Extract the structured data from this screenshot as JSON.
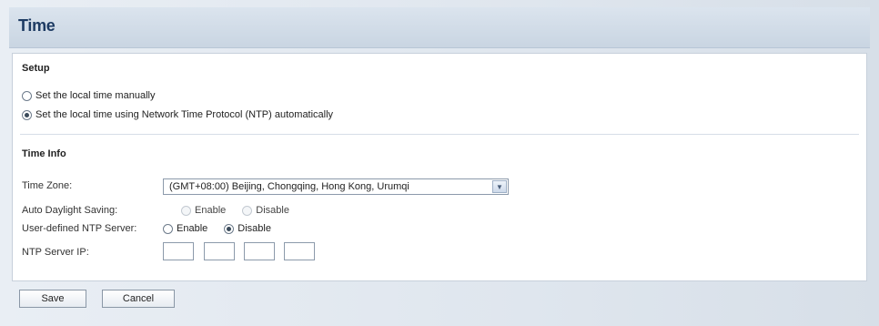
{
  "page": {
    "title": "Time"
  },
  "setup": {
    "heading": "Setup",
    "options": [
      {
        "label": "Set the local time manually",
        "selected": false
      },
      {
        "label": "Set the local time using Network Time Protocol (NTP) automatically",
        "selected": true
      }
    ]
  },
  "time_info": {
    "heading": "Time Info",
    "time_zone": {
      "label": "Time Zone:",
      "value": "(GMT+08:00) Beijing, Chongqing, Hong Kong, Urumqi"
    },
    "auto_dst": {
      "label": "Auto Daylight Saving:",
      "enable_label": "Enable",
      "disable_label": "Disable",
      "selected": "none",
      "disabled": true
    },
    "user_ntp": {
      "label": "User-defined NTP Server:",
      "enable_label": "Enable",
      "disable_label": "Disable",
      "selected": "Disable"
    },
    "ntp_ip": {
      "label": "NTP Server IP:",
      "octets": [
        "",
        "",
        "",
        ""
      ]
    }
  },
  "buttons": {
    "save": "Save",
    "cancel": "Cancel"
  }
}
